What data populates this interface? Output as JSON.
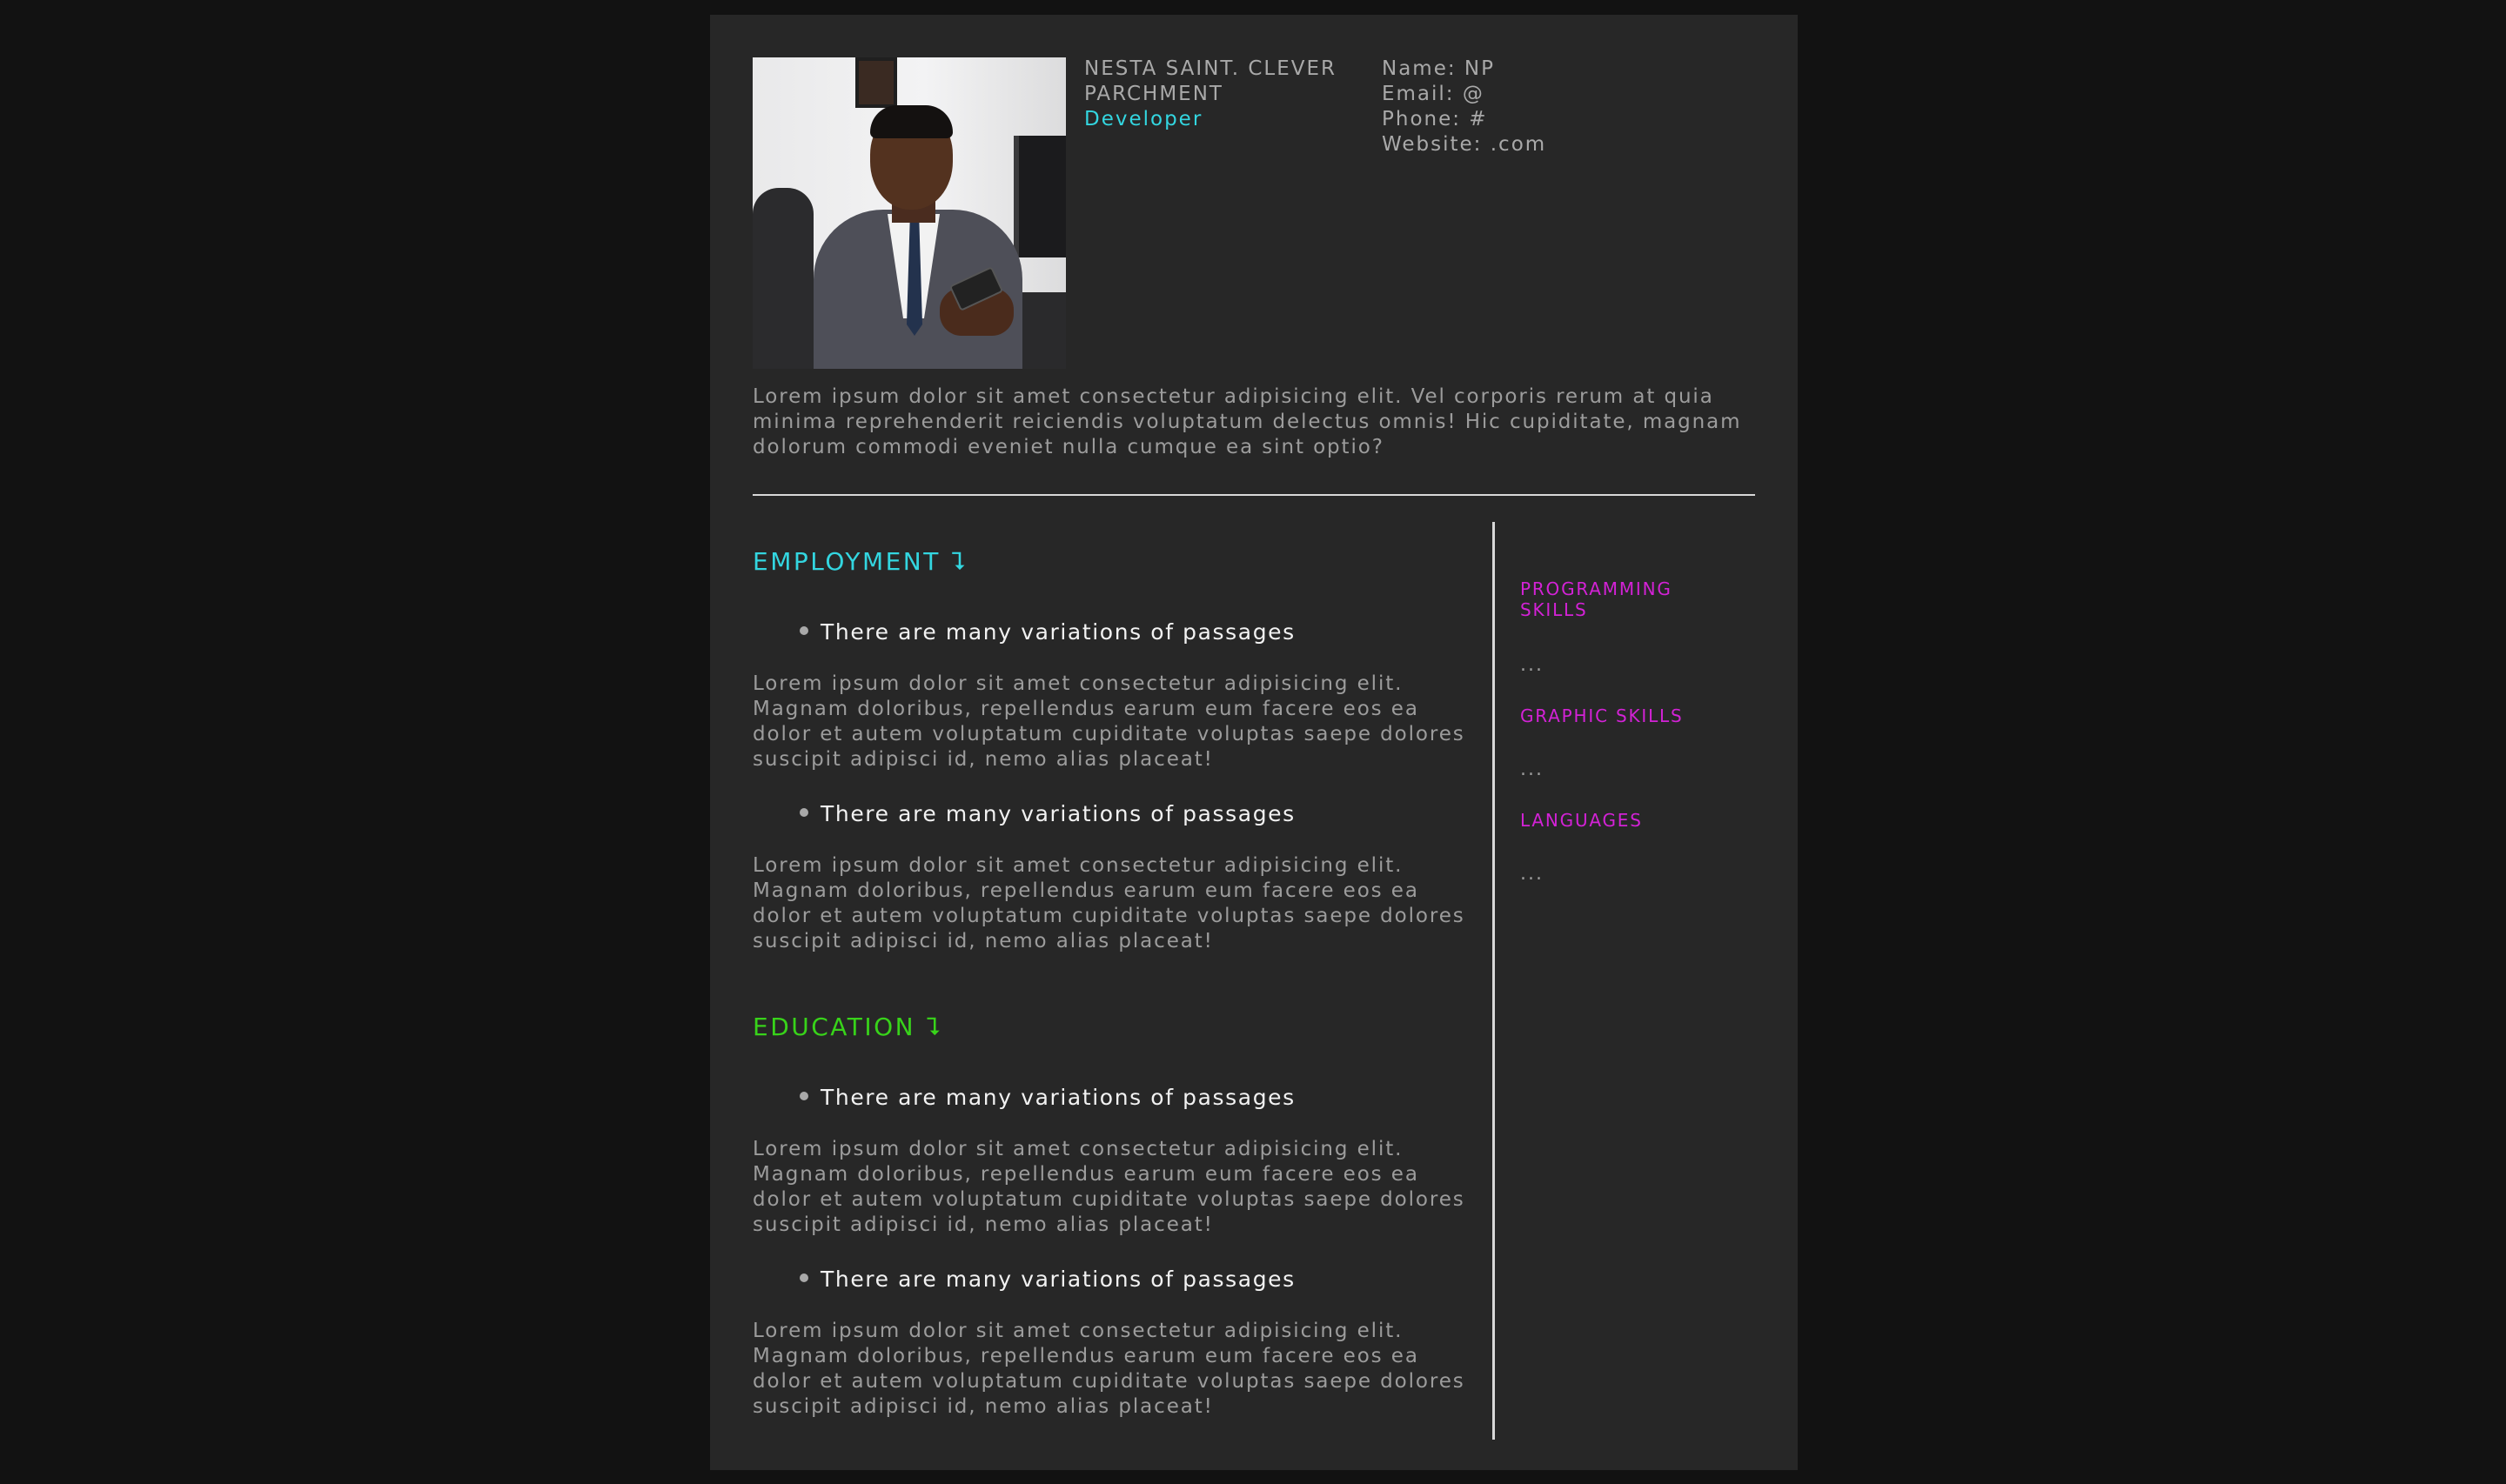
{
  "profile": {
    "name": "NESTA SAINT. CLEVER PARCHMENT",
    "name_line1": "NESTA SAINT. CLEVER",
    "name_line2": "PARCHMENT",
    "title": "Developer",
    "title_color": "#33d6e0"
  },
  "contact": {
    "name": "Name: NP",
    "email": "Email: @",
    "phone": "Phone: #",
    "website": "Website: .com"
  },
  "summary": "Lorem ipsum dolor sit amet consectetur adipisicing elit. Vel corporis rerum at quia minima reprehenderit reiciendis voluptatum delectus omnis! Hic cupiditate, magnam dolorum commodi eveniet nulla cumque ea sint optio?",
  "employment": {
    "heading": "EMPLOYMENT",
    "arrow": "⮧",
    "color": "#33d6e0",
    "items": [
      {
        "title": "There are many variations of passages",
        "body": "Lorem ipsum dolor sit amet consectetur adipisicing elit. Magnam doloribus, repellendus earum eum facere eos ea dolor et autem voluptatum cupiditate voluptas saepe dolores suscipit adipisci id, nemo alias placeat!"
      },
      {
        "title": "There are many variations of passages",
        "body": "Lorem ipsum dolor sit amet consectetur adipisicing elit. Magnam doloribus, repellendus earum eum facere eos ea dolor et autem voluptatum cupiditate voluptas saepe dolores suscipit adipisci id, nemo alias placeat!"
      }
    ]
  },
  "education": {
    "heading": "EDUCATION",
    "arrow": "⮧",
    "color": "#38d31a",
    "items": [
      {
        "title": "There are many variations of passages",
        "body": "Lorem ipsum dolor sit amet consectetur adipisicing elit. Magnam doloribus, repellendus earum eum facere eos ea dolor et autem voluptatum cupiditate voluptas saepe dolores suscipit adipisci id, nemo alias placeat!"
      },
      {
        "title": "There are many variations of passages",
        "body": "Lorem ipsum dolor sit amet consectetur adipisicing elit. Magnam doloribus, repellendus earum eum facere eos ea dolor et autem voluptatum cupiditate voluptas saepe dolores suscipit adipisci id, nemo alias placeat!"
      }
    ]
  },
  "sidebar": {
    "color": "#d322d6",
    "sections": [
      {
        "heading": "PROGRAMMING SKILLS",
        "value": "..."
      },
      {
        "heading": "GRAPHIC SKILLS",
        "value": "..."
      },
      {
        "heading": "LANGUAGES",
        "value": "..."
      }
    ]
  },
  "colors": {
    "background": "#121212",
    "page": "#272727",
    "text_muted": "#9c9c9c",
    "text_bright": "#f2f2f2"
  }
}
